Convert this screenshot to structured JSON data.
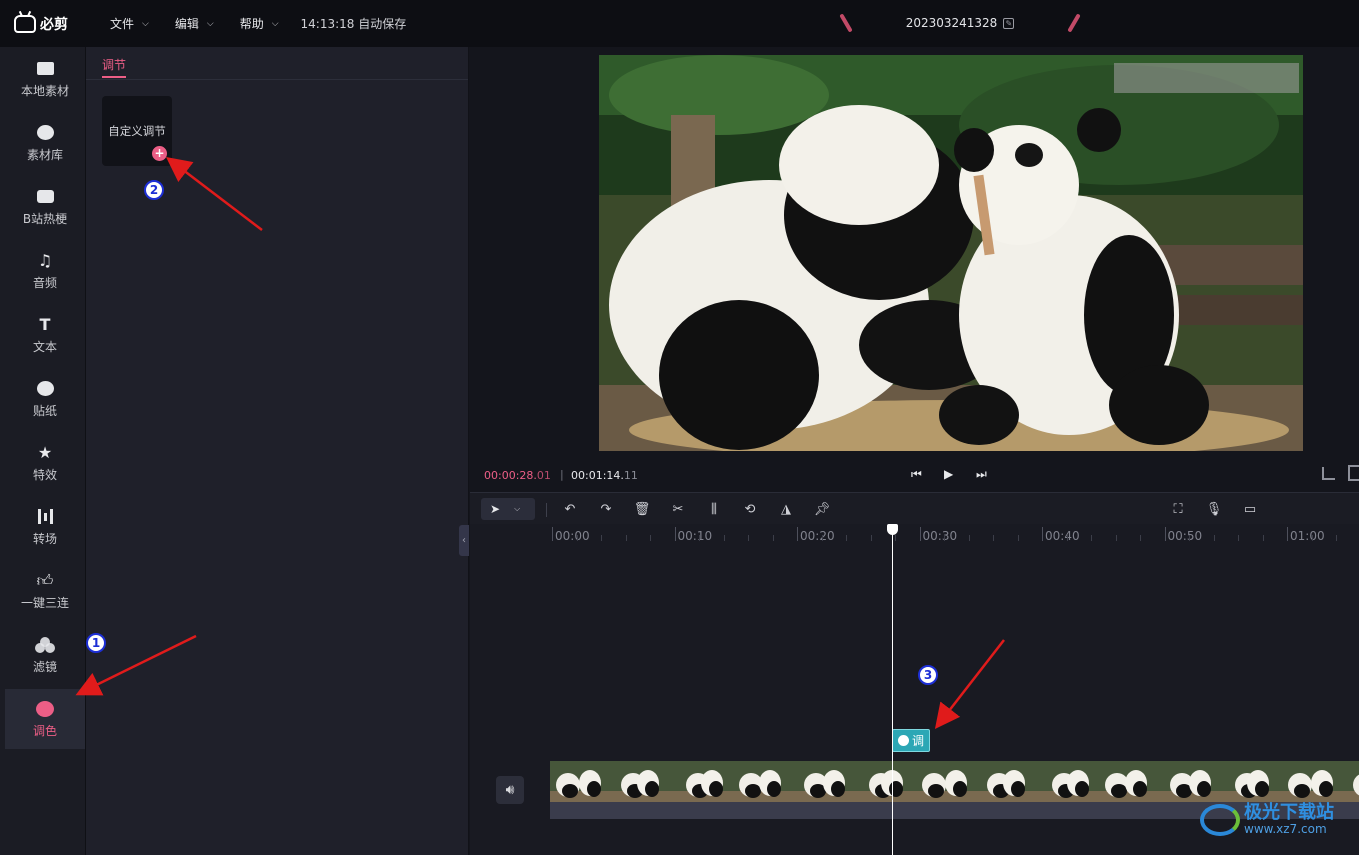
{
  "app": {
    "logo_text": "必剪",
    "menus": [
      {
        "label": "文件"
      },
      {
        "label": "编辑"
      },
      {
        "label": "帮助"
      }
    ],
    "autosave": "14:13:18 自动保存",
    "project_name": "202303241328"
  },
  "sidebar": {
    "items": [
      {
        "label": "本地素材",
        "icon": "upload-folder-icon"
      },
      {
        "label": "素材库",
        "icon": "material-library-icon"
      },
      {
        "label": "B站热梗",
        "icon": "bilibili-tv-icon"
      },
      {
        "label": "音频",
        "icon": "music-note-icon"
      },
      {
        "label": "文本",
        "icon": "text-t-icon"
      },
      {
        "label": "贴纸",
        "icon": "sticker-icon"
      },
      {
        "label": "特效",
        "icon": "sparkle-star-icon"
      },
      {
        "label": "转场",
        "icon": "transition-icon"
      },
      {
        "label": "一键三连",
        "icon": "thumbs-up-icon"
      },
      {
        "label": "滤镜",
        "icon": "filter-circles-icon"
      },
      {
        "label": "调色",
        "icon": "palette-icon",
        "active": true
      }
    ]
  },
  "panel": {
    "tab_label": "调节",
    "card_label": "自定义调节",
    "card_add_symbol": "+"
  },
  "player": {
    "current_time_main": "00:00:28.",
    "current_time_frames": "01",
    "separator": "|",
    "total_time_main": "00:01:14.",
    "total_time_frames": "11"
  },
  "timeline": {
    "ruler_labels": [
      "00:00",
      "00:10",
      "00:20",
      "00:30",
      "00:40",
      "00:50",
      "01:00"
    ],
    "clip_tag_label": "调"
  },
  "annotations": {
    "badge_1": "1",
    "badge_2": "2",
    "badge_3": "3",
    "arrow_color": "#e01b1b"
  },
  "watermark": {
    "name": "极光下载站",
    "url": "www.xz7.com"
  },
  "colors": {
    "accent": "#ec5e86",
    "clip_tag": "#2ca7b5",
    "badge_border": "#1d2fd6"
  }
}
